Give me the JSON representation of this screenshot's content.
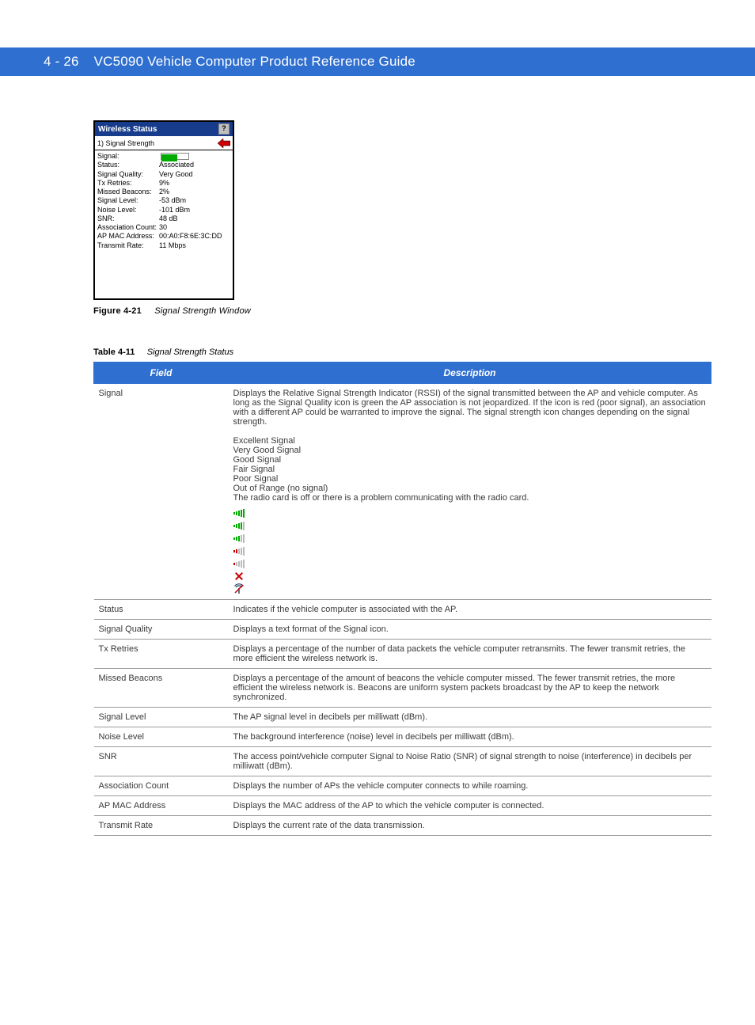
{
  "header": {
    "pageNum": "4 - 26",
    "title": "VC5090 Vehicle Computer Product Reference Guide"
  },
  "screenshot": {
    "windowTitle": "Wireless Status",
    "subTitle": "1) Signal Strength",
    "rows": [
      {
        "label": "Signal:",
        "value": ""
      },
      {
        "label": "Status:",
        "value": "Associated"
      },
      {
        "label": "Signal Quality:",
        "value": "Very Good"
      },
      {
        "label": "Tx Retries:",
        "value": "9%"
      },
      {
        "label": "Missed Beacons:",
        "value": "2%"
      },
      {
        "label": "Signal Level:",
        "value": "-53 dBm"
      },
      {
        "label": "Noise Level:",
        "value": "-101 dBm"
      },
      {
        "label": "SNR:",
        "value": "48 dB"
      },
      {
        "label": "Association Count:",
        "value": "30"
      },
      {
        "label": "AP MAC Address:",
        "value": "00:A0:F8:6E:3C:DD"
      },
      {
        "label": "Transmit Rate:",
        "value": "11 Mbps"
      }
    ]
  },
  "figure": {
    "labelBold": "Figure 4-21",
    "labelRest": "Signal Strength Window"
  },
  "tableTitle": {
    "bold": "Table 4-11",
    "rest": "Signal Strength Status"
  },
  "tableHead": {
    "col1": "Field",
    "col2": "Description"
  },
  "tableRows": [
    {
      "field": "Signal",
      "desc": "Displays the Relative Signal Strength Indicator (RSSI) of the signal transmitted between the AP and vehicle computer. As long as the Signal Quality icon is green the AP association is not jeopardized. If the icon is red (poor signal), an association with a different AP could be warranted to improve the signal. The signal strength icon changes depending on the signal strength.\n\nExcellent Signal\nVery Good Signal\nGood Signal\nFair Signal\nPoor Signal\nOut of Range (no signal)\nThe radio card is off or there is a problem communicating with the radio card."
    },
    {
      "field": "Status",
      "desc": "Indicates if the vehicle computer is associated with the AP."
    },
    {
      "field": "Signal Quality",
      "desc": "Displays a text format of the Signal icon."
    },
    {
      "field": "Tx Retries",
      "desc": "Displays a percentage of the number of data packets the vehicle computer retransmits. The fewer transmit retries, the more efficient the wireless network is."
    },
    {
      "field": "Missed Beacons",
      "desc": "Displays a percentage of the amount of beacons the vehicle computer missed. The fewer transmit retries, the more efficient the wireless network is. Beacons are uniform system packets broadcast by the AP to keep the network synchronized."
    },
    {
      "field": "Signal Level",
      "desc": "The AP signal level in decibels per milliwatt (dBm)."
    },
    {
      "field": "Noise Level",
      "desc": "The background interference (noise) level in decibels per milliwatt (dBm)."
    },
    {
      "field": "SNR",
      "desc": "The access point/vehicle computer Signal to Noise Ratio (SNR) of signal strength to noise (interference) in decibels per milliwatt (dBm)."
    },
    {
      "field": "Association Count",
      "desc": "Displays the number of APs the vehicle computer connects to while roaming."
    },
    {
      "field": "AP MAC Address",
      "desc": "Displays the MAC address of the AP to which the vehicle computer is connected."
    },
    {
      "field": "Transmit Rate",
      "desc": "Displays the current rate of the data transmission."
    }
  ]
}
